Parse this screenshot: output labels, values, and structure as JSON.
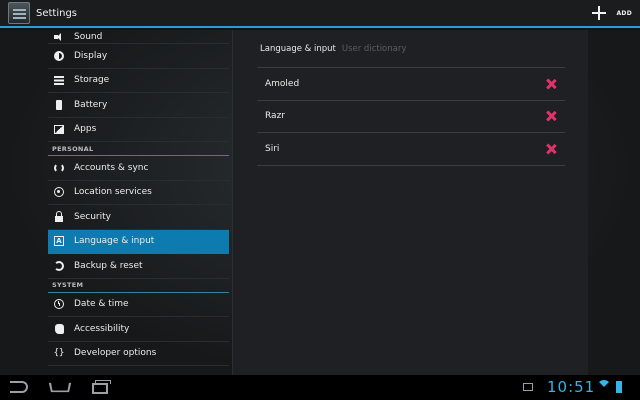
{
  "actionbar": {
    "title": "Settings",
    "add_label": "ADD"
  },
  "sidebar": {
    "items": [
      {
        "label": "Sound",
        "icon": "sound-icon"
      },
      {
        "label": "Display",
        "icon": "display-icon"
      },
      {
        "label": "Storage",
        "icon": "storage-icon"
      },
      {
        "label": "Battery",
        "icon": "battery-icon"
      },
      {
        "label": "Apps",
        "icon": "apps-icon"
      }
    ],
    "personal_header": "PERSONAL",
    "personal": [
      {
        "label": "Accounts & sync",
        "icon": "sync-icon"
      },
      {
        "label": "Location services",
        "icon": "location-icon"
      },
      {
        "label": "Security",
        "icon": "lock-icon"
      },
      {
        "label": "Language & input",
        "icon": "language-icon",
        "active": true
      },
      {
        "label": "Backup & reset",
        "icon": "backup-icon"
      }
    ],
    "system_header": "SYSTEM",
    "system": [
      {
        "label": "Date & time",
        "icon": "clock-icon"
      },
      {
        "label": "Accessibility",
        "icon": "hand-icon"
      },
      {
        "label": "Developer options",
        "icon": "braces-icon"
      }
    ]
  },
  "panel": {
    "breadcrumb": {
      "current": "Language & input",
      "next": "User dictionary"
    },
    "words": [
      "Amoled",
      "Razr",
      "Siri"
    ]
  },
  "status": {
    "time": "10:51"
  }
}
